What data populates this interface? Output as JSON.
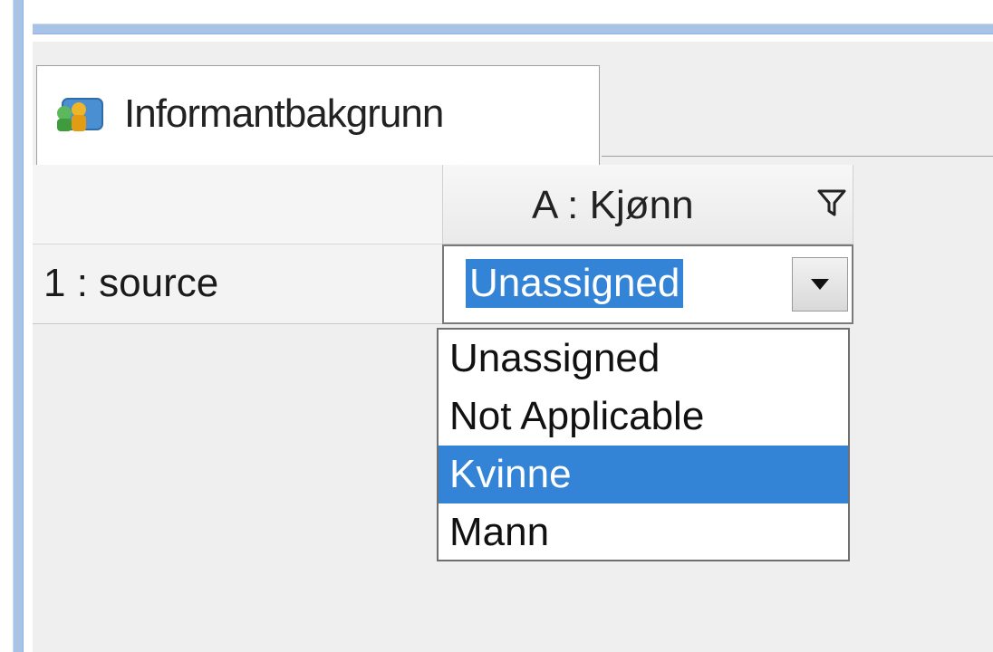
{
  "tab": {
    "label": "Informantbakgrunn",
    "icon": "users-icon"
  },
  "grid": {
    "column_header": "A : Kjønn",
    "column_filter_icon": "filter-icon",
    "rows": [
      {
        "label": "1 : source",
        "value": "Unassigned"
      }
    ]
  },
  "dropdown": {
    "options": [
      "Unassigned",
      "Not Applicable",
      "Kvinne",
      "Mann"
    ],
    "highlighted": "Kvinne",
    "arrow_icon": "chevron-down-icon"
  },
  "colors": {
    "selection": "#3383d6",
    "window_frame": "#a9c3e6",
    "panel_background": "#efefef"
  }
}
